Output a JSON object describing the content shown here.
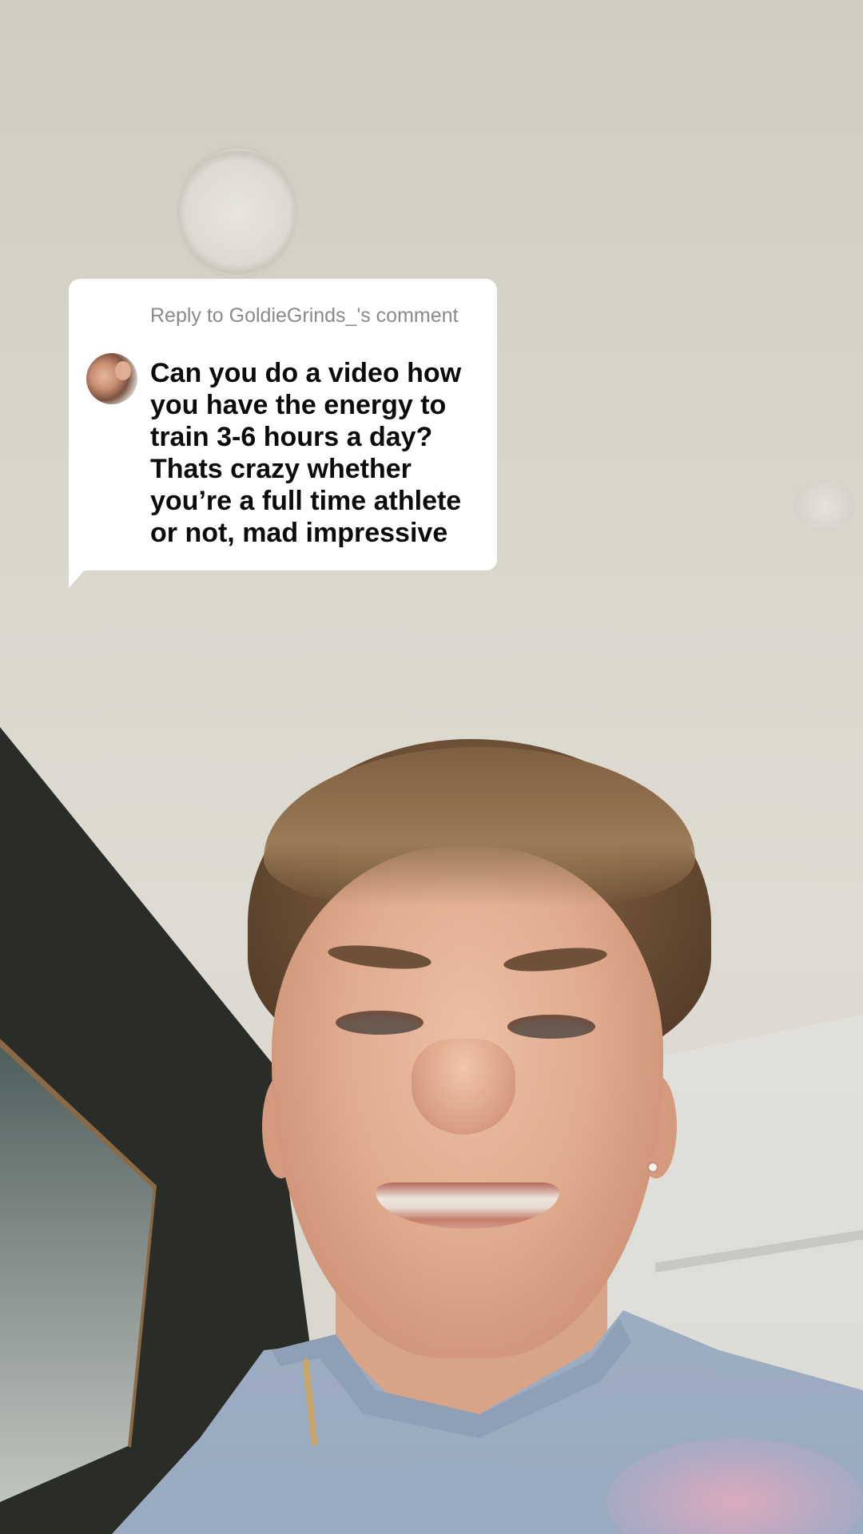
{
  "reply_sticker": {
    "header": "Reply to GoldieGrinds_'s comment",
    "comment_text": "Can you do a video how you have the energy to train 3-6 hours a day? Thats crazy whether you’re a full time athlete or not, mad impressive"
  },
  "colors": {
    "sticker_background": "#ffffff",
    "header_text": "#8a8a8a",
    "comment_text": "#0b0b0b"
  }
}
